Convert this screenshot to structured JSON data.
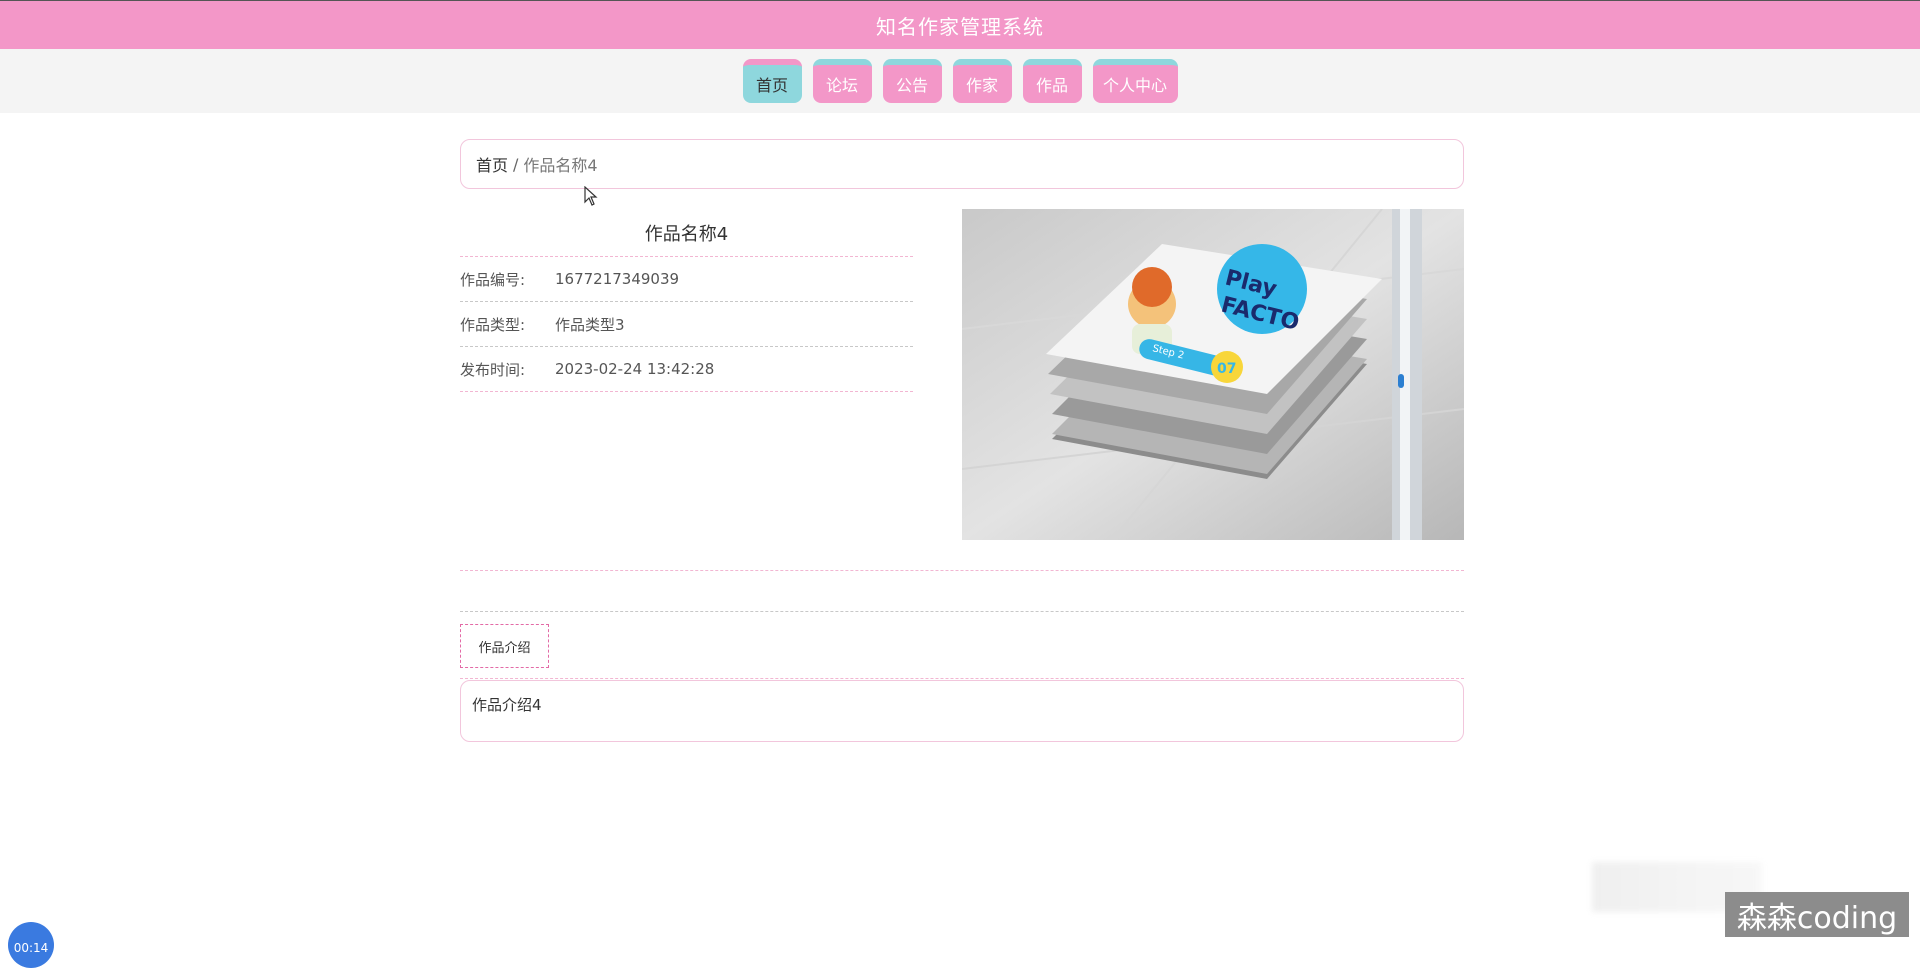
{
  "header": {
    "title": "知名作家管理系统"
  },
  "nav": {
    "items": [
      {
        "label": "首页"
      },
      {
        "label": "论坛"
      },
      {
        "label": "公告"
      },
      {
        "label": "作家"
      },
      {
        "label": "作品"
      },
      {
        "label": "个人中心"
      }
    ]
  },
  "breadcrumb": {
    "home": "首页",
    "separator": "/",
    "current": "作品名称4"
  },
  "detail": {
    "title": "作品名称4",
    "fields": [
      {
        "label": "作品编号:",
        "value": "1677217349039"
      },
      {
        "label": "作品类型:",
        "value": "作品类型3"
      },
      {
        "label": "发布时间:",
        "value": "2023-02-24 13:42:28"
      }
    ],
    "image": {
      "cover_title_line1": "Play",
      "cover_title_line2": "FACTO",
      "step_label": "Step 2",
      "step_number": "07"
    }
  },
  "tabs": [
    {
      "label": "作品介绍"
    }
  ],
  "description": {
    "text": "作品介绍4"
  },
  "overlay": {
    "watermark": "森森coding",
    "timer": "00:14"
  },
  "colors": {
    "primary_pink": "#f397c8",
    "accent_teal": "#8ed7dd"
  }
}
